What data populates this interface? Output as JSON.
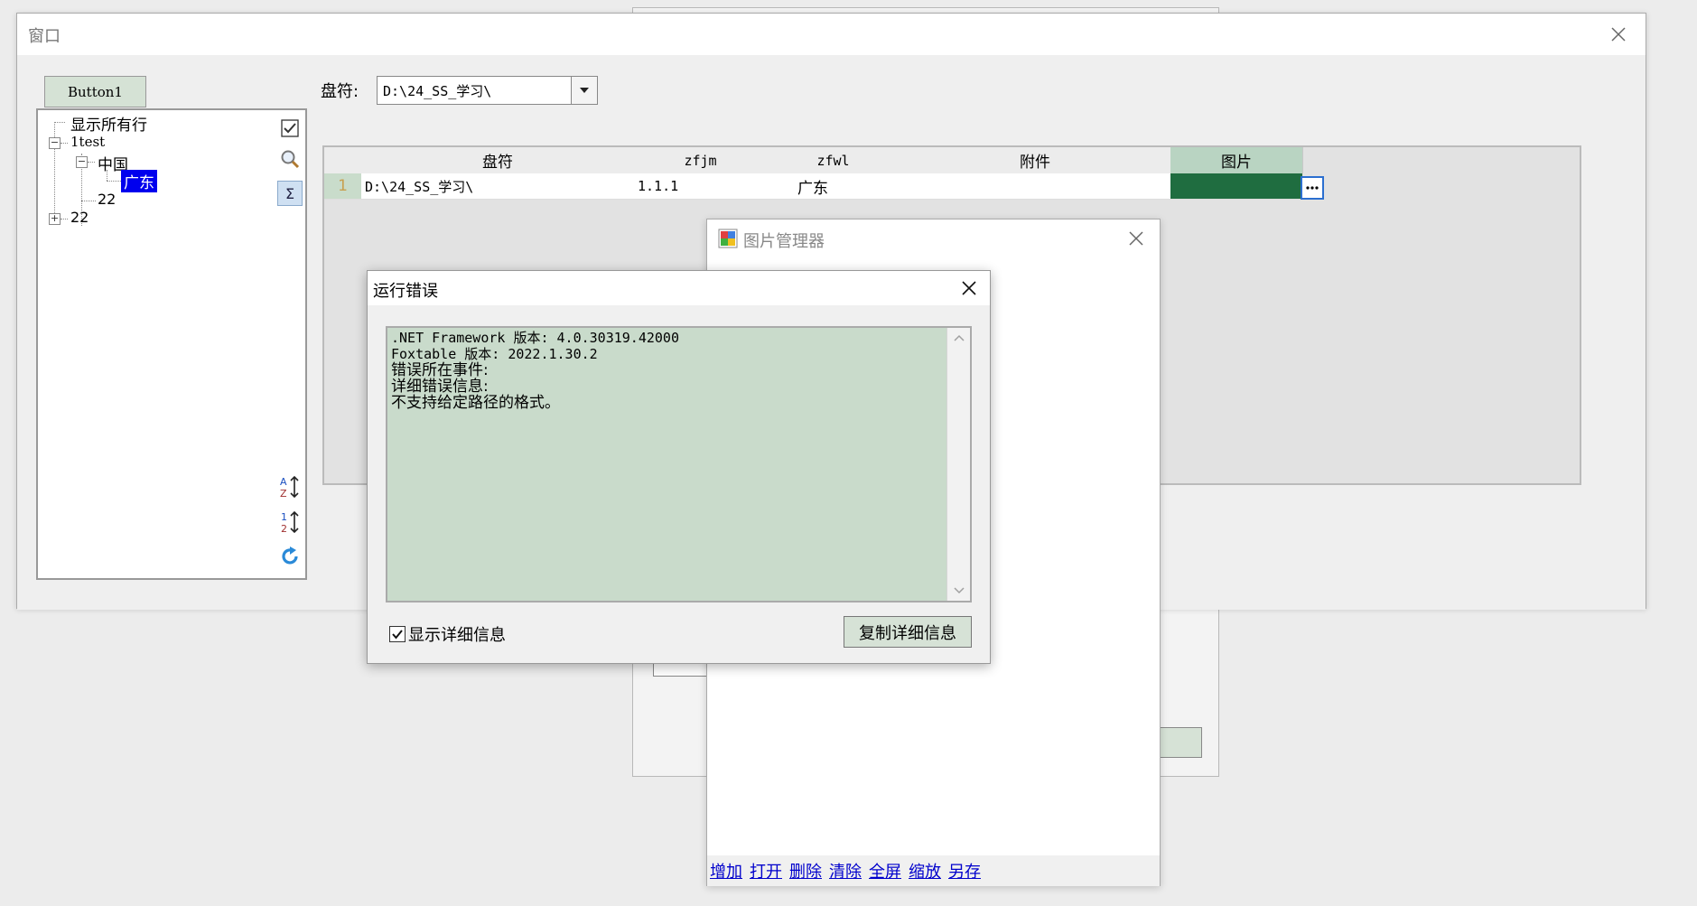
{
  "main_window": {
    "title": "窗口",
    "button1_label": "Button1",
    "drive_label": "盘符:",
    "drive_value": "D:\\24_SS_学习\\"
  },
  "tree": {
    "show_all": "显示所有行",
    "nodes": [
      "1test",
      "中国",
      "广东",
      "22",
      "22"
    ]
  },
  "grid": {
    "columns": [
      "盘符",
      "zfjm",
      "zfwl",
      "附件",
      "图片"
    ],
    "rows": [
      {
        "num": "1",
        "cells": [
          "D:\\24_SS_学习\\",
          "1.1.1",
          "广东",
          "",
          ""
        ]
      }
    ]
  },
  "image_manager": {
    "title": "图片管理器",
    "toolbar": [
      "增加",
      "打开",
      "删除",
      "清除",
      "全屏",
      "缩放",
      "另存"
    ]
  },
  "error_dialog": {
    "title": "运行错误",
    "lines": [
      ".NET Framework 版本: 4.0.30319.42000",
      "Foxtable 版本: 2022.1.30.2",
      "错误所在事件:",
      "详细错误信息:",
      "不支持给定路径的格式。"
    ],
    "show_details_label": "显示详细信息",
    "show_details_checked": true,
    "copy_button_label": "复制详细信息"
  },
  "back_window": {
    "button_fragment": ")"
  },
  "colors": {
    "grid_selected_cell": "#1f6d40",
    "header_active": "#b9d4c2",
    "error_text_bg": "#c9dbcb",
    "button_bg": "#d6e2d6",
    "tree_selection": "#0000ee",
    "link": "#0000cc"
  },
  "icons": [
    "checkbox-icon",
    "search-icon",
    "sum-icon",
    "sort-alpha-icon",
    "sort-numeric-icon",
    "refresh-icon",
    "image-manager-icon",
    "close-icon",
    "ellipsis-icon",
    "dropdown-arrow-icon"
  ]
}
